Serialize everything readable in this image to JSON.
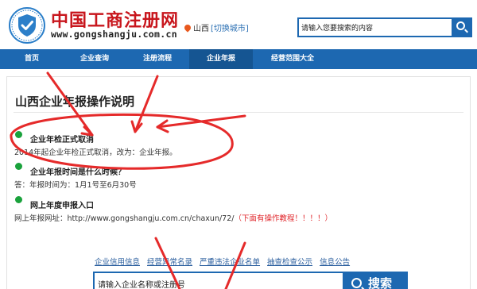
{
  "header": {
    "site_name": "中国工商注册网",
    "site_url": "www.gongshangju.com.cn",
    "city": "山西",
    "city_switch": "[切换城市]",
    "search_placeholder": "请输入您要搜索的内容"
  },
  "nav": {
    "items": [
      "首页",
      "企业查询",
      "注册流程",
      "企业年报",
      "经营范围大全"
    ],
    "active": "企业年报"
  },
  "main": {
    "title": "山西企业年报操作说明",
    "sections": [
      {
        "title": "企业年检正式取消",
        "text": "2014年起企业年检正式取消，改为：企业年报。"
      },
      {
        "title": "企业年报时间是什么时候？",
        "text": "答：年报时间为：1月1号至6月30号"
      },
      {
        "title": "网上年度申报入口",
        "text": "网上年报网址：http://www.gongshangju.com.cn/chaxun/72/",
        "note": "（下面有操作教程！！！！）"
      }
    ],
    "links": [
      "企业信用信息",
      "经营异常名录",
      "严重违法企业名单",
      "抽查检查公示",
      "信息公告"
    ],
    "search": {
      "placeholder": "请输入企业名称或注册号",
      "button_label": "搜索"
    }
  },
  "colors": {
    "brand_blue": "#1d68b1",
    "brand_red": "#c8161d",
    "annotation_red": "#e52a2a",
    "bullet_green": "#1aa23c"
  }
}
